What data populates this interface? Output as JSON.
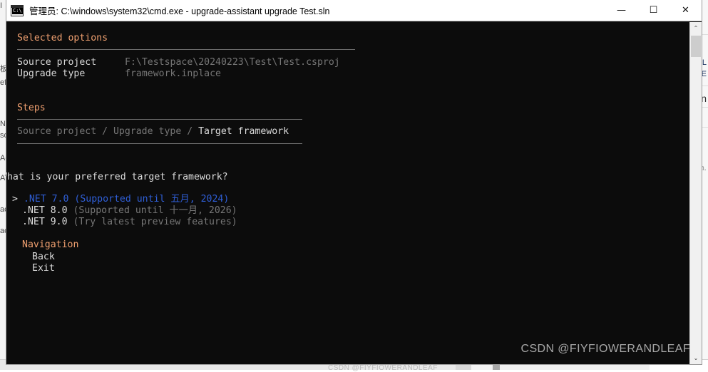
{
  "window": {
    "title": "管理员: C:\\windows\\system32\\cmd.exe - upgrade-assistant  upgrade Test.sln",
    "icon_label": "C:\\",
    "minimize_label": "—",
    "maximize_label": "☐",
    "close_label": "✕",
    "background_color": "#0c0c0c",
    "titlebar_color": "#ffffff"
  },
  "colors": {
    "heading": "#f0a070",
    "selected": "#2f5fd8",
    "dim": "#767676",
    "bright": "#dcdcdc",
    "rule": "#6e6e6e"
  },
  "console": {
    "selected_options": {
      "heading": "Selected options",
      "rows": [
        {
          "label": "Source project",
          "value": "F:\\Testspace\\20240223\\Test\\Test.csproj"
        },
        {
          "label": "Upgrade type",
          "value": "framework.inplace"
        }
      ]
    },
    "steps": {
      "heading": "Steps",
      "breadcrumb": [
        {
          "text": "Source project",
          "state": "done"
        },
        {
          "text": "/",
          "state": "done"
        },
        {
          "text": "Upgrade type",
          "state": "done"
        },
        {
          "text": "/",
          "state": "done"
        },
        {
          "text": "Target framework",
          "state": "current"
        }
      ],
      "breadcrumb_text": "Source project / Upgrade type / Target framework"
    },
    "prompt": {
      "question": "What is your preferred target framework?",
      "cursor": ">",
      "options": [
        {
          "name": ".NET 7.0",
          "note": "(Supported until 五月, 2024)",
          "selected": true
        },
        {
          "name": ".NET 8.0",
          "note": "(Supported until 十一月, 2026)",
          "selected": false
        },
        {
          "name": ".NET 9.0",
          "note": "(Try latest preview features)",
          "selected": false
        }
      ]
    },
    "navigation": {
      "heading": "Navigation",
      "items": [
        "Back",
        "Exit"
      ]
    }
  },
  "scrollbar": {
    "up_arrow": "⌃",
    "down_arrow": "⌄"
  },
  "watermark": {
    "text": "CSDN @FIYFIOWERANDLEAF"
  },
  "background": {
    "left_fragments": [
      "I",
      "板",
      "ef",
      "N",
      "so",
      "Ad",
      "AT",
      "ac",
      "ac"
    ],
    "right_fragments": [
      "L",
      "E",
      "in",
      "a."
    ],
    "bottom_text": "CSDN @FIYFIOWERANDLEAF"
  }
}
